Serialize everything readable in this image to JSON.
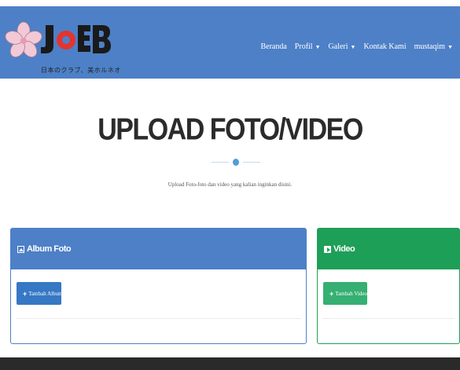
{
  "brand": {
    "logo_text": "日本のクラブ、美ホルネオ"
  },
  "nav": {
    "items": [
      {
        "label": "Beranda",
        "dropdown": false
      },
      {
        "label": "Profil",
        "dropdown": true
      },
      {
        "label": "Galeri",
        "dropdown": true
      },
      {
        "label": "Kontak Kami",
        "dropdown": false
      },
      {
        "label": "mustaqim",
        "dropdown": true
      }
    ],
    "caret": "▼"
  },
  "hero": {
    "title": "UPLOAD FOTO/VIDEO",
    "subtitle": "Upload Foto-foto dan video yang kalian inginkan disini."
  },
  "panels": {
    "album": {
      "title": "Album Foto",
      "button": "Tambah Album",
      "icon": "image-icon"
    },
    "video": {
      "title": "Video",
      "button": "Tambah Video",
      "icon": "video-icon"
    }
  },
  "colors": {
    "navbar": "#4d80c7",
    "album_header": "#4d80c7",
    "video_header": "#1e9f58",
    "album_button": "#3678c4",
    "video_button": "#35b072",
    "accent_dot": "#4d9fd6",
    "footer": "#2a2a2a"
  }
}
